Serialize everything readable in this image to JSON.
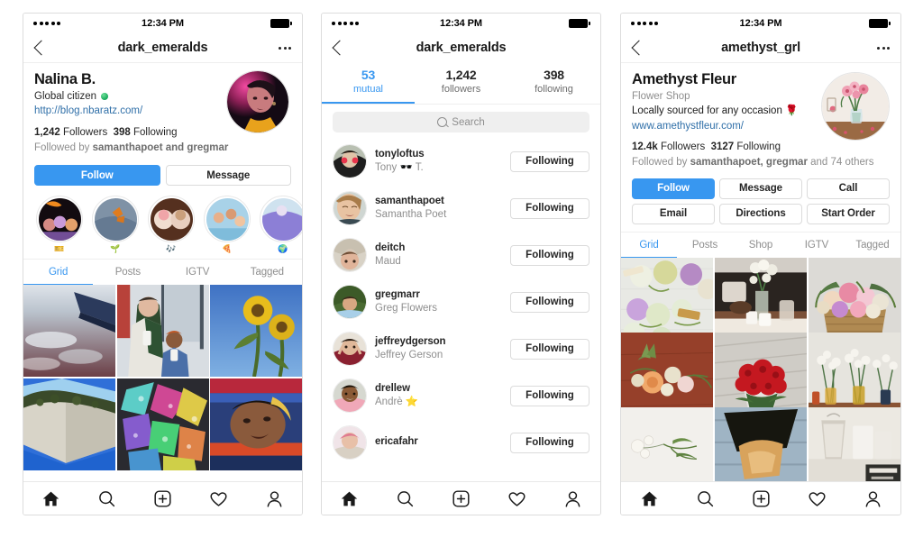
{
  "app": "Instagram",
  "phones": [
    {
      "id": "profile-personal",
      "statusbar": {
        "time": "12:34 PM",
        "signal_dots": 5
      },
      "nav": {
        "title": "dark_emeralds",
        "back_icon": "chevron-left-icon",
        "more_icon": "more-options-icon"
      },
      "profile": {
        "display_name": "Nalina B.",
        "category": "Global citizen",
        "category_emoji": "🌎",
        "website": "http://blog.nbaratz.com/",
        "followers_count": "1,242",
        "followers_label": "Followers",
        "following_count": "398",
        "following_label": "Following",
        "followed_by": "Followed by samanthapoet and gregmar",
        "followed_by_prefix": "Followed by ",
        "followed_by_names": "samanthapoet and gregmar"
      },
      "actions": [
        {
          "label": "Follow",
          "style": "primary"
        },
        {
          "label": "Message",
          "style": "default"
        }
      ],
      "highlights": [
        {
          "label": "🎫"
        },
        {
          "label": "🌱"
        },
        {
          "label": "🎶"
        },
        {
          "label": "🍕"
        },
        {
          "label": "🌍"
        }
      ],
      "tabs": [
        {
          "label": "Grid",
          "active": true
        },
        {
          "label": "Posts",
          "active": false
        },
        {
          "label": "IGTV",
          "active": false
        },
        {
          "label": "Tagged",
          "active": false
        }
      ],
      "grid": [
        {
          "alt": "airplane-wing-above-clouds-sunset"
        },
        {
          "alt": "two-friends-with-drinks-by-window"
        },
        {
          "alt": "sunflowers-against-blue-sky"
        },
        {
          "alt": "ivy-on-concrete-building-corner"
        },
        {
          "alt": "holographic-rainbow-prism-texture"
        },
        {
          "alt": "person-in-striped-shirt-portrait"
        }
      ]
    },
    {
      "id": "followers-list",
      "statusbar": {
        "time": "12:34 PM",
        "signal_dots": 5
      },
      "nav": {
        "title": "dark_emeralds",
        "back_icon": "chevron-left-icon"
      },
      "segments": [
        {
          "count": "53",
          "label": "mutual",
          "active": true
        },
        {
          "count": "1,242",
          "label": "followers",
          "active": false
        },
        {
          "count": "398",
          "label": "following",
          "active": false
        }
      ],
      "search": {
        "placeholder": "Search",
        "value": "",
        "icon": "search-icon"
      },
      "users": [
        {
          "username": "tonyloftus",
          "fullname": "Tony 🕶️ T.",
          "button": "Following"
        },
        {
          "username": "samanthapoet",
          "fullname": "Samantha Poet",
          "button": "Following"
        },
        {
          "username": "deitch",
          "fullname": "Maud",
          "button": "Following"
        },
        {
          "username": "gregmarr",
          "fullname": "Greg Flowers",
          "button": "Following"
        },
        {
          "username": "jeffreydgerson",
          "fullname": "Jeffrey Gerson",
          "button": "Following"
        },
        {
          "username": "drellew",
          "fullname": "Andrè ⭐",
          "button": "Following"
        },
        {
          "username": "ericafahr",
          "fullname": "",
          "button": "Following"
        }
      ]
    },
    {
      "id": "profile-business",
      "statusbar": {
        "time": "12:34 PM",
        "signal_dots": 5
      },
      "nav": {
        "title": "amethyst_grl",
        "back_icon": "chevron-left-icon",
        "more_icon": "more-options-icon"
      },
      "profile": {
        "display_name": "Amethyst Fleur",
        "category": "Flower Shop",
        "bio": "Locally sourced for any occasion 🌹",
        "website": "www.amethystfleur.com/",
        "followers_count": "12.4k",
        "followers_label": "Followers",
        "following_count": "3127",
        "following_label": "Following",
        "followed_by_prefix": "Followed by ",
        "followed_by_names": "samanthapoet, gregmar",
        "followed_by_suffix": " and 74 others"
      },
      "actions_row1": [
        {
          "label": "Follow",
          "style": "primary"
        },
        {
          "label": "Message",
          "style": "default"
        },
        {
          "label": "Call",
          "style": "default"
        }
      ],
      "actions_row2": [
        {
          "label": "Email",
          "style": "default"
        },
        {
          "label": "Directions",
          "style": "default"
        },
        {
          "label": "Start Order",
          "style": "default"
        }
      ],
      "tabs": [
        {
          "label": "Grid",
          "active": true
        },
        {
          "label": "Posts",
          "active": false
        },
        {
          "label": "Shop",
          "active": false
        },
        {
          "label": "IGTV",
          "active": false
        },
        {
          "label": "Tagged",
          "active": false
        }
      ],
      "grid": [
        {
          "alt": "boutonnieres-on-white-cloth"
        },
        {
          "alt": "white-flowers-in-vase-living-room"
        },
        {
          "alt": "pastel-bouquet-in-wicker-basket"
        },
        {
          "alt": "peach-rose-arrangement-on-wood"
        },
        {
          "alt": "red-roses-bouquet-on-pavement"
        },
        {
          "alt": "white-flowers-in-glass-vases-shelf"
        },
        {
          "alt": "sprig-on-white-surface"
        },
        {
          "alt": "wrapped-bouquet-on-blue-wood"
        },
        {
          "alt": "vases-with-sign-our-new"
        }
      ]
    }
  ],
  "tabbar": {
    "items": [
      {
        "icon": "home-icon",
        "label": "Home",
        "active": true
      },
      {
        "icon": "search-icon",
        "label": "Search",
        "active": false
      },
      {
        "icon": "add-post-icon",
        "label": "New Post",
        "active": false
      },
      {
        "icon": "heart-icon",
        "label": "Activity",
        "active": false
      },
      {
        "icon": "profile-icon",
        "label": "Profile",
        "active": false
      }
    ]
  },
  "colors": {
    "accent": "#3897f0",
    "text": "#262626",
    "muted": "#8e8e8e",
    "border": "#dbdbdb",
    "link": "#2f6fa8"
  }
}
